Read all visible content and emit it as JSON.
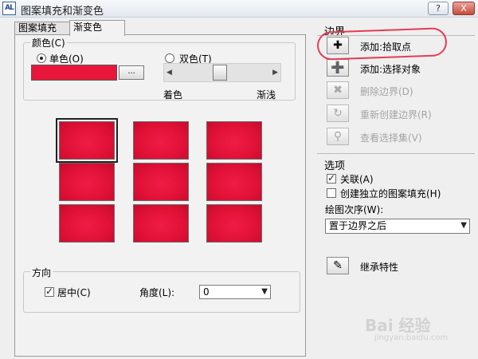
{
  "window": {
    "title": "图案填充和渐变色",
    "help_label": "?",
    "close_label": "X"
  },
  "tabs": [
    {
      "label": "图案填充"
    },
    {
      "label": "渐变色"
    }
  ],
  "color": {
    "group_label": "颜色(C)",
    "single_label": "单色(O)",
    "double_label": "双色(T)",
    "browse_label": "...",
    "swatch_color": "#e8163b",
    "tint_label": "着色",
    "shade_label": "渐浅"
  },
  "gradient_swatches": {
    "count": 9,
    "selected_index": 0,
    "fill_color": "#e21138"
  },
  "direction": {
    "group_label": "方向",
    "centered_label": "居中(C)",
    "centered_checked": true,
    "angle_label": "角度(L):",
    "angle_value": "0"
  },
  "boundary": {
    "section_label": "边界",
    "actions": [
      {
        "label": "添加:拾取点",
        "icon": "pick-point-icon",
        "enabled": true
      },
      {
        "label": "添加:选择对象",
        "icon": "select-objects-icon",
        "enabled": true
      },
      {
        "label": "删除边界(D)",
        "icon": "remove-boundary-icon",
        "enabled": false
      },
      {
        "label": "重新创建边界(R)",
        "icon": "recreate-boundary-icon",
        "enabled": false
      },
      {
        "label": "查看选择集(V)",
        "icon": "view-selection-icon",
        "enabled": false
      }
    ]
  },
  "options": {
    "section_label": "选项",
    "associative_label": "关联(A)",
    "associative_checked": true,
    "separate_label": "创建独立的图案填充(H)",
    "separate_checked": false,
    "draw_order_label": "绘图次序(W):",
    "draw_order_value": "置于边界之后"
  },
  "inherit_label": "继承特性",
  "watermark": {
    "main": "Bai 经验",
    "sub": "jingyan.baidu.com"
  },
  "accent_colors": {
    "fill_red": "#e21138",
    "annotation_ring": "#e53b55"
  }
}
